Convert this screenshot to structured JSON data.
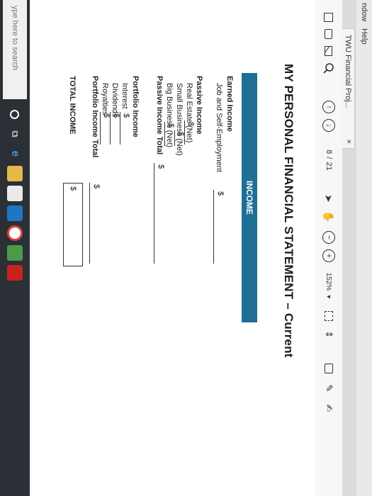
{
  "menu": {
    "window": "ndow",
    "help": "Help"
  },
  "tab": {
    "title": "TWU Financial Proj...",
    "close": "×"
  },
  "toolbar": {
    "page_current": "8",
    "page_sep": "/",
    "page_total": "21",
    "zoom": "152%",
    "zoom_caret": "▾"
  },
  "document": {
    "title": "MY PERSONAL FINANCIAL STATEMENT – Current",
    "income_header": "INCOME",
    "earned_income": {
      "heading": "Earned Income",
      "items": [
        {
          "label": "Job and Self-Employment",
          "currency": "$"
        }
      ]
    },
    "passive_income": {
      "heading": "Passive Income",
      "items": [
        {
          "label": "Real Estate (Net)",
          "currency": "$"
        },
        {
          "label": "Small Business (Net)",
          "currency": "$"
        },
        {
          "label": "Big Business (Net)",
          "currency": "$"
        }
      ],
      "total_label": "Passive Income Total",
      "total_currency": "$"
    },
    "portfolio_income": {
      "heading": "Portfolio Income",
      "items": [
        {
          "label": "Interest",
          "currency": "$"
        },
        {
          "label": "Dividends",
          "currency": "$"
        },
        {
          "label": "Royalties",
          "currency": "$"
        }
      ],
      "total_label": "Portfolio Income Total",
      "total_currency": "$"
    },
    "total_income": {
      "label": "TOTAL INCOME",
      "currency": "$"
    }
  },
  "taskbar": {
    "search_placeholder": "ype here to search",
    "icons": [
      "start-icon",
      "task-view-icon",
      "edge-icon",
      "file-explorer-icon",
      "store-icon",
      "mail-icon",
      "chrome-icon",
      "calculator-icon",
      "acrobat-icon"
    ]
  },
  "colors": {
    "accent": "#1f6e95",
    "taskbar": "#2b2f36"
  }
}
